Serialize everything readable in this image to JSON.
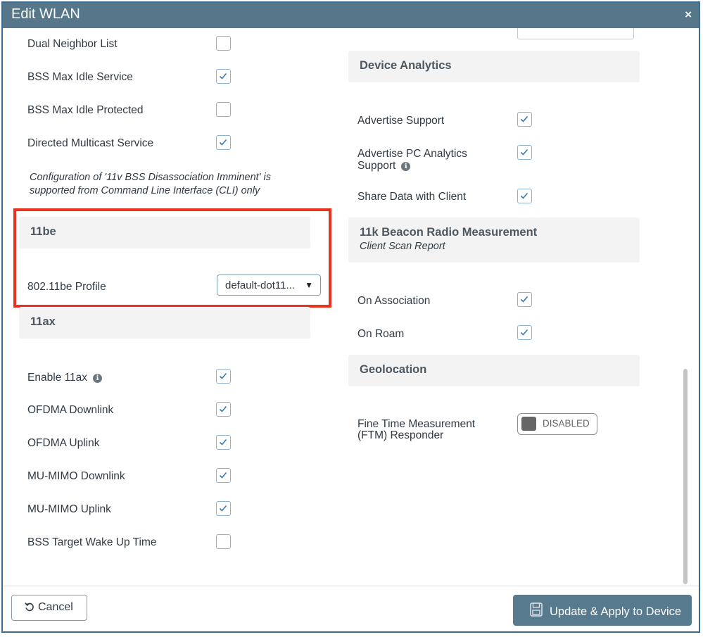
{
  "dialog": {
    "title": "Edit WLAN",
    "close_icon": "×"
  },
  "left": {
    "rows_top": [
      {
        "label": "Dual Neighbor List",
        "checked": false
      },
      {
        "label": "BSS Max Idle Service",
        "checked": true
      },
      {
        "label": "BSS Max Idle Protected",
        "checked": false
      },
      {
        "label": "Directed Multicast Service",
        "checked": true
      }
    ],
    "note_line1": "Configuration of '11v BSS Disassociation Imminent' is",
    "note_line2": "supported from Command Line Interface (CLI) only",
    "section_11be": {
      "title": "11be",
      "profile_label": "802.11be Profile",
      "profile_value": "default-dot11...",
      "profile_caret": "▼"
    },
    "section_11ax": {
      "title": "11ax",
      "rows": [
        {
          "label": "Enable 11ax",
          "checked": true,
          "info": true
        },
        {
          "label": "OFDMA Downlink",
          "checked": true
        },
        {
          "label": "OFDMA Uplink",
          "checked": true
        },
        {
          "label": "MU-MIMO Downlink",
          "checked": true
        },
        {
          "label": "MU-MIMO Uplink",
          "checked": true
        },
        {
          "label": "BSS Target Wake Up Time",
          "checked": false
        }
      ]
    }
  },
  "right": {
    "device_analytics": {
      "title": "Device Analytics",
      "advertise_support": "Advertise Support",
      "advertise_pc_line1": "Advertise PC Analytics",
      "advertise_pc_line2": "Support",
      "share_data": "Share Data with Client"
    },
    "beacon": {
      "title": "11k Beacon Radio Measurement",
      "subtitle": "Client Scan Report",
      "on_association": "On Association",
      "on_roam": "On Roam"
    },
    "geolocation": {
      "title": "Geolocation",
      "ftm_line1": "Fine Time Measurement",
      "ftm_line2": "(FTM) Responder",
      "toggle_text": "DISABLED"
    }
  },
  "footer": {
    "cancel_label": "Cancel",
    "apply_label": "Update & Apply to Device"
  },
  "icons": {
    "info_glyph": "i"
  },
  "colors": {
    "titlebar": "#56768a",
    "checkbox_border": "#8fb3d6",
    "checkmark": "#3d78b0",
    "highlight_box": "#e8321f",
    "apply_button": "#587a8e"
  }
}
